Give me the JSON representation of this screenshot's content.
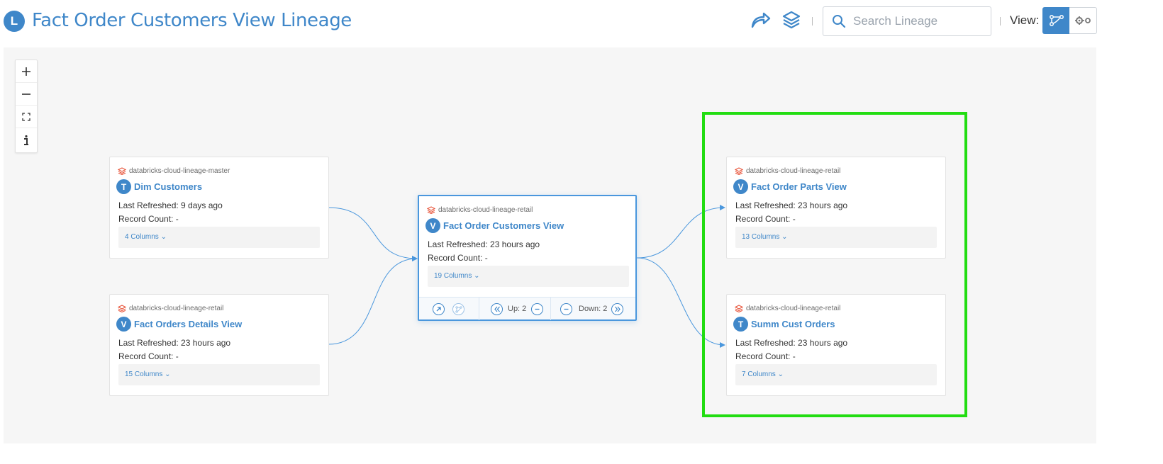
{
  "header": {
    "badge_letter": "L",
    "title": "Fact Order Customers View Lineage",
    "icons": [
      "share-icon",
      "layers-icon"
    ],
    "search_placeholder": "Search Lineage",
    "view_label": "View:",
    "view_modes": [
      "lineage-graph-icon",
      "settings-connector-icon"
    ]
  },
  "zoom_controls": [
    "zoom-in-icon",
    "zoom-out-icon",
    "fit-screen-icon",
    "info-icon"
  ],
  "nodes": {
    "dim_customers": {
      "source": "databricks-cloud-lineage-master",
      "type": "T",
      "name": "Dim Customers",
      "last_refreshed": "Last Refreshed: 9 days ago",
      "record_count": "Record Count: -",
      "columns": "4 Columns ⌄"
    },
    "fact_orders_details": {
      "source": "databricks-cloud-lineage-retail",
      "type": "V",
      "name": "Fact Orders Details View",
      "last_refreshed": "Last Refreshed: 23 hours ago",
      "record_count": "Record Count: -",
      "columns": "15 Columns ⌄"
    },
    "center": {
      "source": "databricks-cloud-lineage-retail",
      "type": "V",
      "name": "Fact Order Customers View",
      "last_refreshed": "Last Refreshed: 23 hours ago",
      "record_count": "Record Count: -",
      "columns": "19 Columns ⌄",
      "up_label": "Up: 2",
      "down_label": "Down: 2"
    },
    "fact_order_parts": {
      "source": "databricks-cloud-lineage-retail",
      "type": "V",
      "name": "Fact Order Parts View",
      "last_refreshed": "Last Refreshed: 23 hours ago",
      "record_count": "Record Count: -",
      "columns": "13 Columns ⌄"
    },
    "summ_cust_orders": {
      "source": "databricks-cloud-lineage-retail",
      "type": "T",
      "name": "Summ Cust Orders",
      "last_refreshed": "Last Refreshed: 23 hours ago",
      "record_count": "Record Count: -",
      "columns": "7 Columns ⌄"
    }
  },
  "colors": {
    "accent": "#3f87c9",
    "highlight": "#22dd11",
    "databricks": "#e8543a"
  }
}
